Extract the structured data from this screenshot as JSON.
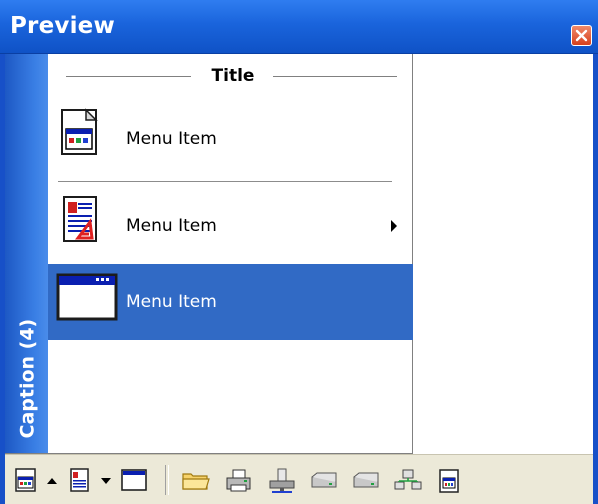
{
  "window": {
    "title": "Preview",
    "caption": "Caption (4)",
    "title_bar_color": "#1a64dc",
    "close_color": "#d6401d"
  },
  "menu": {
    "title": "Title",
    "selection_color": "#316ac5",
    "items": [
      {
        "label": "Menu Item",
        "icon": "application-icon",
        "has_submenu": false,
        "selected": false
      },
      {
        "label": "Menu Item",
        "icon": "document-icon",
        "has_submenu": true,
        "selected": false
      },
      {
        "label": "Menu Item",
        "icon": "window-icon",
        "has_submenu": false,
        "selected": true
      }
    ]
  },
  "toolbar": {
    "items": [
      {
        "icon": "application-icon",
        "has_dropdown": true,
        "dropdown": "up"
      },
      {
        "icon": "document-icon",
        "has_dropdown": true,
        "dropdown": "down"
      },
      {
        "icon": "window-icon"
      },
      {
        "icon": "folder-icon"
      },
      {
        "icon": "printer-icon"
      },
      {
        "icon": "network-drive-icon"
      },
      {
        "icon": "drive-icon"
      },
      {
        "icon": "drive-icon"
      },
      {
        "icon": "network-icon"
      },
      {
        "icon": "properties-icon"
      }
    ]
  }
}
